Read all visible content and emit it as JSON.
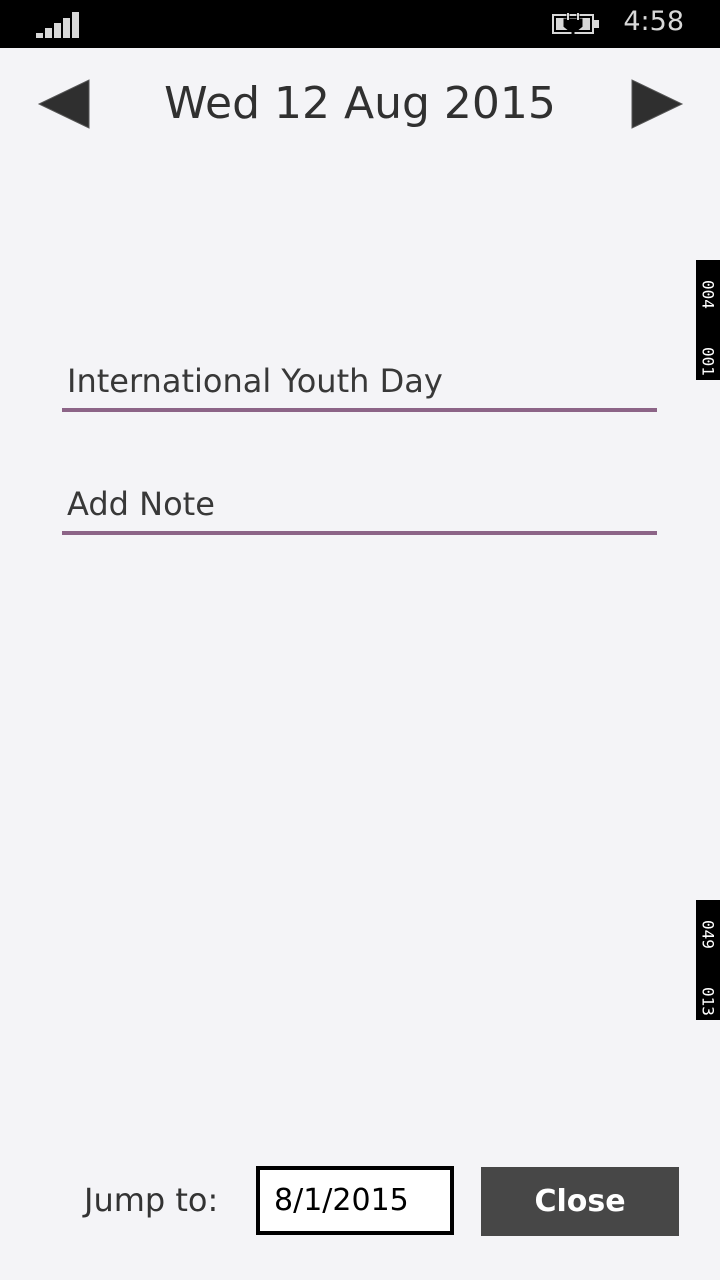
{
  "status_bar": {
    "time": "4:58",
    "signal_icon": "signal-strength-icon",
    "battery_icon": "battery-charging-icon"
  },
  "header": {
    "title": "Wed 12 Aug 2015",
    "prev_icon": "triangle-left-icon",
    "next_icon": "triangle-right-icon"
  },
  "event": {
    "value": "International Youth Day"
  },
  "note": {
    "placeholder": "Add Note"
  },
  "side_tags": {
    "top": [
      "004",
      "001"
    ],
    "bottom": [
      "049",
      "013"
    ]
  },
  "footer": {
    "jump_label": "Jump to:",
    "date_value": "8/1/2015",
    "close_label": "Close"
  },
  "colors": {
    "background": "#f4f4f7",
    "accent_underline": "#8c6487",
    "close_button_bg": "#474747",
    "status_bar_bg": "#000000"
  }
}
